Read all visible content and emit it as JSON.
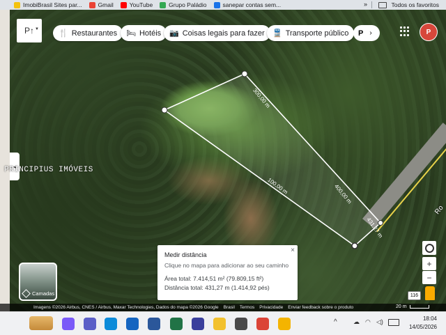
{
  "bookmarks": [
    {
      "label": "ImobiBrasil Sites par...",
      "icon": "imobibrasil-icon",
      "color": "#f4c20d"
    },
    {
      "label": "Gmail",
      "icon": "gmail-icon",
      "color": "#ea4335"
    },
    {
      "label": "YouTube",
      "icon": "youtube-icon",
      "color": "#ff0000"
    },
    {
      "label": "Grupo Paládio",
      "icon": "chrome-icon",
      "color": "#34a853"
    },
    {
      "label": "sanepar contas sem...",
      "icon": "sanepar-icon",
      "color": "#1a73e8"
    }
  ],
  "bookmarks_more": "»",
  "favorites_label": "Todos os favoritos",
  "map": {
    "search_symbol": "P↑",
    "chips": [
      {
        "label": "Restaurantes",
        "icon": "🍴"
      },
      {
        "label": "Hotéis",
        "icon": "🛏"
      },
      {
        "label": "Coisas legais para fazer",
        "icon": "📷"
      },
      {
        "label": "Transporte público",
        "icon": "🚆"
      }
    ],
    "chip_more_label": "P",
    "chip_more_arrow": "›",
    "avatar_text": "P",
    "watermark": "PRINCIPIUS IMÓVEIS",
    "segment_labels": [
      "300,00 m",
      "400,00 m",
      "431,27 m",
      "100,00 m"
    ],
    "measure": {
      "title": "Medir distância",
      "subtitle": "Clique no mapa para adicionar ao seu caminho",
      "area": "Área total: 7.414,51 m² (79.809,15 ft²)",
      "distance": "Distância total: 431,27 m (1.414,92 pés)",
      "close": "×"
    },
    "layers_label": "Camadas",
    "route_badge": "116",
    "road_label": "Ro",
    "footer": [
      "Imagens ©2026 Airbus, CNES / Airbus, Maxar Technologies, Dados do mapa ©2026 Google",
      "Brasil",
      "Termos",
      "Privacidade",
      "Enviar feedback sobre o produto"
    ],
    "scale": "20 m",
    "zoom_in": "+",
    "zoom_out": "−"
  },
  "taskbar": {
    "time": "18:04",
    "date": "14/05/2026",
    "apps": [
      {
        "name": "copilot-icon",
        "color": "#7a5af8"
      },
      {
        "name": "teams-icon",
        "color": "#5b5fc7"
      },
      {
        "name": "edge-icon",
        "color": "#0c8bd9"
      },
      {
        "name": "mail-icon",
        "color": "#1565c0"
      },
      {
        "name": "word-icon",
        "color": "#2b579a"
      },
      {
        "name": "excel-icon",
        "color": "#217346"
      },
      {
        "name": "onenote-icon",
        "color": "#3a3f9c"
      },
      {
        "name": "norton-icon",
        "color": "#f2c12e"
      },
      {
        "name": "settings-app-icon",
        "color": "#4a4a4a"
      },
      {
        "name": "chrome-icon",
        "color": "#db4437"
      },
      {
        "name": "explorer-icon",
        "color": "#f4b400"
      }
    ]
  }
}
